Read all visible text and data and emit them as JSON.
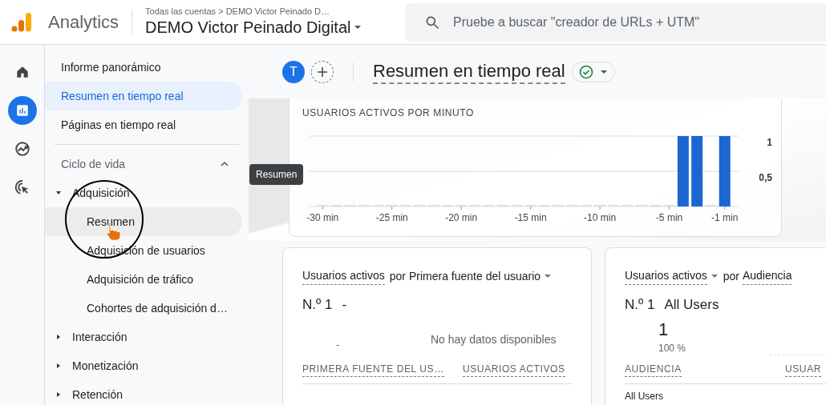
{
  "topbar": {
    "product": "Analytics",
    "breadcrumb": "Todas las cuentas > DEMO Victor Peinado D…",
    "property": "DEMO Victor Peinado Digital",
    "search": {
      "placeholder": "Pruebe a buscar \"creador de URLs + UTM\""
    }
  },
  "rail": [
    {
      "kind": "home",
      "selected": false
    },
    {
      "kind": "reports",
      "selected": true
    },
    {
      "kind": "explore",
      "selected": false
    },
    {
      "kind": "advertising",
      "selected": false
    }
  ],
  "nav": [
    {
      "kind": "link",
      "label": "Informe panorámico",
      "selected": false
    },
    {
      "kind": "link",
      "label": "Resumen en tiempo real",
      "selected": true
    },
    {
      "kind": "link",
      "label": "Páginas en tiempo real",
      "selected": false
    },
    {
      "kind": "section",
      "label": "Ciclo de vida",
      "expanded": true,
      "children": [
        {
          "kind": "group",
          "label": "Adquisición",
          "expanded": true,
          "children": [
            {
              "kind": "sub",
              "label": "Resumen",
              "selected": false,
              "hovered": true
            },
            {
              "kind": "sub",
              "label": "Adquisición de usuarios",
              "selected": false,
              "hovered": false
            },
            {
              "kind": "sub",
              "label": "Adquisición de tráfico",
              "selected": false,
              "hovered": false
            },
            {
              "kind": "sub",
              "label": "Cohortes de adquisición d…",
              "selected": false,
              "hovered": false
            }
          ]
        },
        {
          "kind": "group",
          "label": "Interacción",
          "expanded": false
        },
        {
          "kind": "group",
          "label": "Monetización",
          "expanded": false
        },
        {
          "kind": "group",
          "label": "Retención",
          "expanded": false
        }
      ]
    }
  ],
  "tooltip": "Resumen",
  "header": {
    "avatar": "T",
    "title": "Resumen en tiempo real",
    "verified": true
  },
  "chart_card": {
    "chart_data": {
      "type": "bar",
      "title": "USUARIOS ACTIVOS POR MINUTO",
      "x": [
        -30,
        -29,
        -28,
        -27,
        -26,
        -25,
        -24,
        -23,
        -22,
        -21,
        -20,
        -19,
        -18,
        -17,
        -16,
        -15,
        -14,
        -13,
        -12,
        -11,
        -10,
        -9,
        -8,
        -7,
        -6,
        -5,
        -4,
        -3,
        -2,
        -1
      ],
      "values": [
        0,
        0,
        0,
        0,
        0,
        0,
        0,
        0,
        0,
        0,
        0,
        0,
        0,
        0,
        0,
        0,
        0,
        0,
        0,
        0,
        0,
        0,
        0,
        0,
        0,
        0,
        1,
        1,
        0,
        1
      ],
      "xticks": [
        {
          "value": -30,
          "label": "-30 min"
        },
        {
          "value": -25,
          "label": "-25 min"
        },
        {
          "value": -20,
          "label": "-20 min"
        },
        {
          "value": -15,
          "label": "-15 min"
        },
        {
          "value": -10,
          "label": "-10 min"
        },
        {
          "value": -5,
          "label": "-5 min"
        },
        {
          "value": -1,
          "label": "-1 min"
        }
      ],
      "xlim": [
        -31,
        0
      ],
      "yticks": [
        {
          "value": 0.5,
          "label": "0,5"
        },
        {
          "value": 1,
          "label": "1"
        }
      ],
      "ylim": [
        0,
        1
      ]
    }
  },
  "cards": [
    {
      "metric": "Usuarios activos",
      "metric_caret": false,
      "by": "por",
      "dimension": "Primera fuente del usuario",
      "dimension_caret": true,
      "rank": "N.º 1",
      "top_name": "-",
      "mini": "-",
      "empty_text": "No hay datos disponibles",
      "columns": [
        "PRIMERA FUENTE DEL US…",
        "USUARIOS ACTIVOS"
      ]
    },
    {
      "metric": "Usuarios activos",
      "metric_caret": true,
      "by": "por",
      "dimension": "Audiencia",
      "dimension_caret": false,
      "rank": "N.º 1",
      "top_name": "All Users",
      "top_value": "1",
      "top_share": "100 %",
      "columns": [
        "AUDIENCIA",
        "USUAR"
      ],
      "rows": [
        "All Users"
      ]
    }
  ]
}
